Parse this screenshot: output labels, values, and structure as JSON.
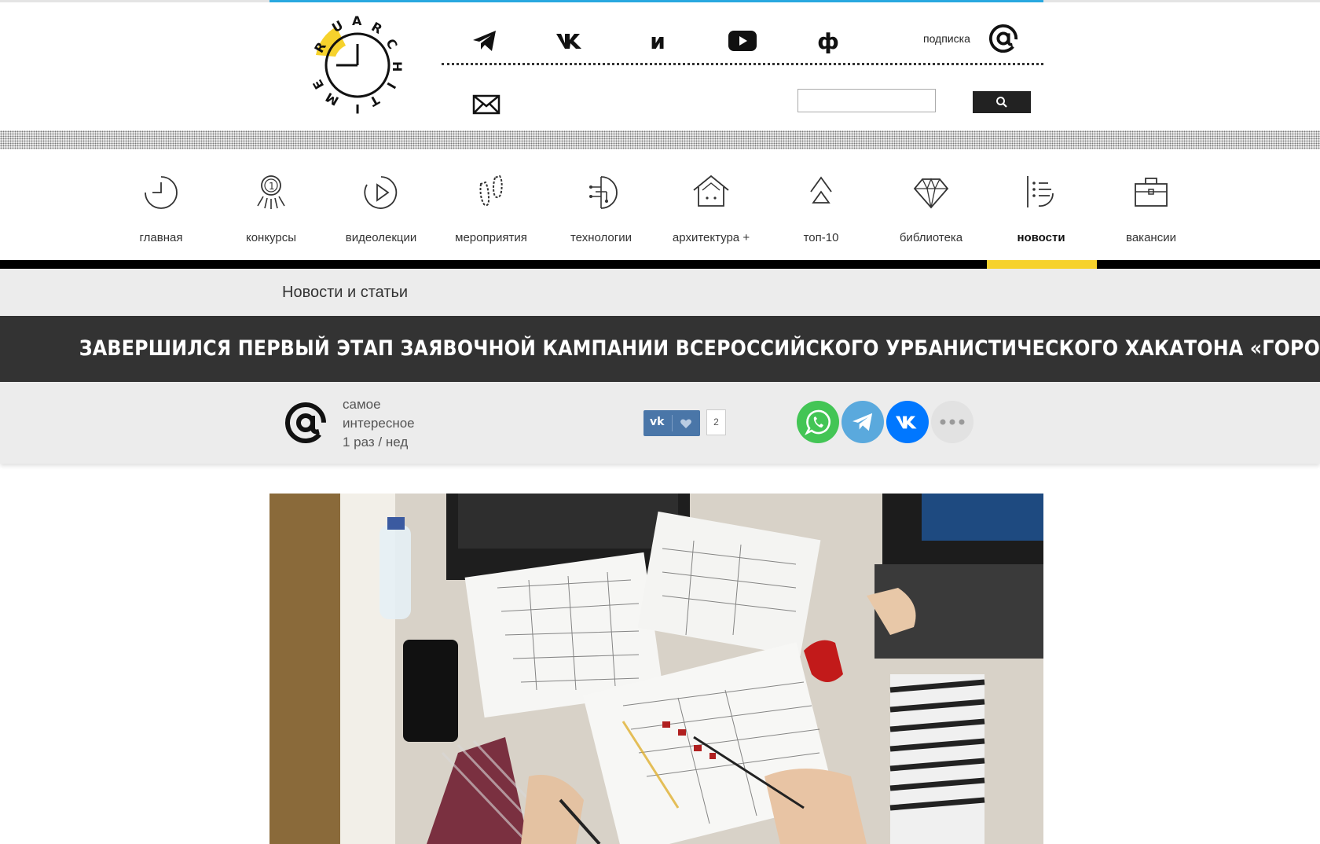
{
  "header": {
    "social": [
      {
        "name": "telegram",
        "icon": "telegram-icon"
      },
      {
        "name": "vk",
        "icon": "vk-icon"
      },
      {
        "name": "i",
        "label": "и"
      },
      {
        "name": "youtube",
        "icon": "youtube-icon"
      },
      {
        "name": "f",
        "label": "ф"
      }
    ],
    "subscribe_label": "подписка",
    "search": {
      "value": "",
      "placeholder": ""
    }
  },
  "nav": {
    "items": [
      {
        "label": "главная",
        "icon": "clock-icon"
      },
      {
        "label": "конкурсы",
        "icon": "medal-icon"
      },
      {
        "label": "видеолекции",
        "icon": "play-icon"
      },
      {
        "label": "мероприятия",
        "icon": "footprints-icon"
      },
      {
        "label": "технологии",
        "icon": "tech-icon"
      },
      {
        "label": "архитектура +",
        "icon": "house-icon"
      },
      {
        "label": "топ-10",
        "icon": "arrow-up-icon"
      },
      {
        "label": "библиотека",
        "icon": "diamond-icon"
      },
      {
        "label": "новости",
        "icon": "list-icon",
        "active": true
      },
      {
        "label": "вакансии",
        "icon": "briefcase-icon"
      }
    ]
  },
  "breadcrumb": "Новости и статьи",
  "article": {
    "title": "ЗАВЕРШИЛСЯ ПЕРВЫЙ ЭТАП ЗАЯВОЧНОЙ КАМПАНИИ ВСЕРОССИЙСКОГО УРБАНИСТИЧЕСКОГО ХАКАТОНА «ГОРОДА»"
  },
  "digest": {
    "line1": "самое",
    "line2": "интересное",
    "line3": "1 раз / нед"
  },
  "like": {
    "logo": "vk",
    "count": "2"
  },
  "colors": {
    "accent_blue": "#29a8e0",
    "active_yellow": "#f6d22c",
    "title_band": "#333333",
    "whatsapp": "#43c555",
    "telegram": "#5aa9dd",
    "vk": "#0077ff"
  }
}
